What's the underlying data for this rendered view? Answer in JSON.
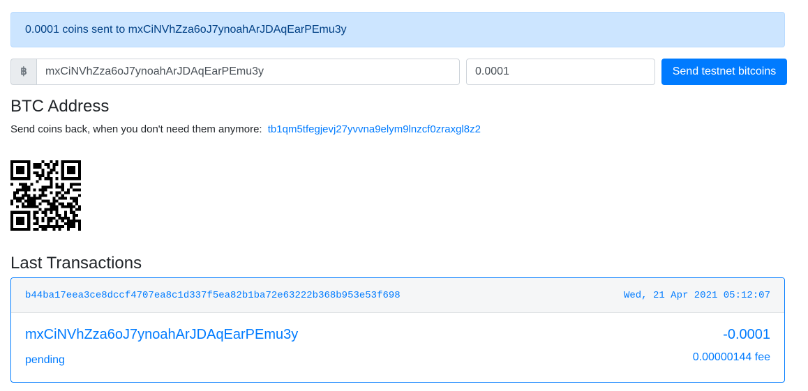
{
  "alert": {
    "message": "0.0001 coins sent to mxCiNVhZza6oJ7ynoahArJDAqEarPEmu3y"
  },
  "send_form": {
    "currency_symbol": "฿",
    "address_value": "mxCiNVhZza6oJ7ynoahArJDAqEarPEmu3y",
    "amount_value": "0.0001",
    "submit_label": "Send testnet bitcoins"
  },
  "btc_address": {
    "heading": "BTC Address",
    "send_back_text": "Send coins back, when you don't need them anymore:",
    "address_link": "tb1qm5tfegjevj27yvvna9elym9lnzcf0zraxgl8z2"
  },
  "transactions": {
    "heading": "Last Transactions",
    "items": [
      {
        "txid": "b44ba17eea3ce8dccf4707ea8c1d337f5ea82b1ba72e63222b368b953e53f698",
        "date": "Wed, 21 Apr 2021 05:12:07",
        "address": "mxCiNVhZza6oJ7ynoahArJDAqEarPEmu3y",
        "amount": "-0.0001",
        "status": "pending",
        "fee": "0.00000144 fee"
      }
    ]
  },
  "colors": {
    "primary": "#007bff",
    "alert_bg": "#cce5ff",
    "alert_text": "#004085"
  }
}
